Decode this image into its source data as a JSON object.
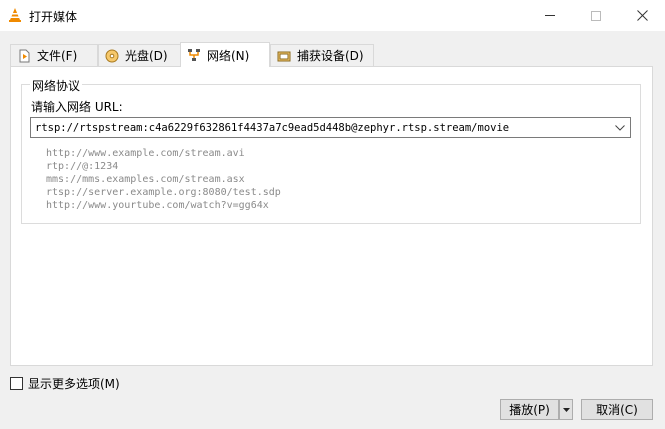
{
  "window": {
    "title": "打开媒体",
    "icon": "vlc-cone-icon"
  },
  "tabs": [
    {
      "label": "文件(F)",
      "icon": "file-icon",
      "active": false
    },
    {
      "label": "光盘(D)",
      "icon": "disc-icon",
      "active": false
    },
    {
      "label": "网络(N)",
      "icon": "network-icon",
      "active": true
    },
    {
      "label": "捕获设备(D)",
      "icon": "capture-device-icon",
      "active": false
    }
  ],
  "network": {
    "group_title": "网络协议",
    "url_label": "请输入网络 URL:",
    "url_value": "rtsp://rtspstream:c4a6229f632861f4437a7c9ead5d448b@zephyr.rtsp.stream/movie",
    "examples": [
      "http://www.example.com/stream.avi",
      "rtp://@:1234",
      "mms://mms.examples.com/stream.asx",
      "rtsp://server.example.org:8080/test.sdp",
      "http://www.yourtube.com/watch?v=gg64x"
    ]
  },
  "options": {
    "show_more_label": "显示更多选项(M)",
    "show_more_checked": false
  },
  "buttons": {
    "play_label": "播放(P)",
    "cancel_label": "取消(C)"
  },
  "colors": {
    "vlc_orange": "#f08a00",
    "example_text": "#8a8a8a"
  }
}
